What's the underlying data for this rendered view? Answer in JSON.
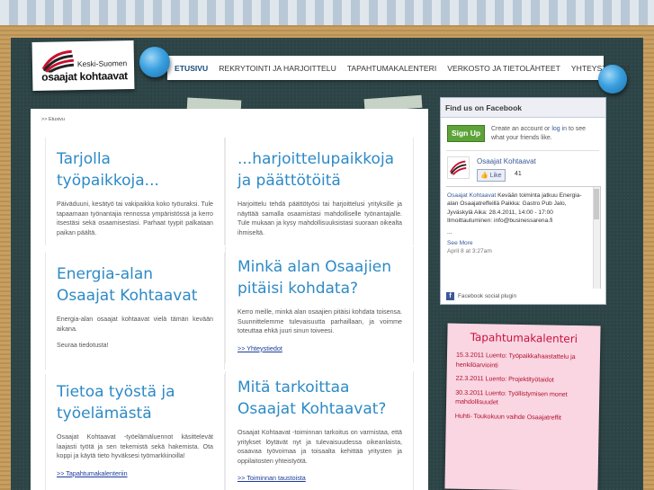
{
  "logo": {
    "line1": "Keski-Suomen",
    "line2": "osaajat kohtaavat"
  },
  "nav": {
    "items": [
      {
        "label": "ETUSIVU",
        "active": true
      },
      {
        "label": "REKRYTOINTI JA HARJOITTELU",
        "active": false
      },
      {
        "label": "TAPAHTUMAKALENTERI",
        "active": false
      },
      {
        "label": "VERKOSTO JA TIETOLÄHTEET",
        "active": false
      },
      {
        "label": "YHTEYSTIEDOT",
        "active": false
      }
    ]
  },
  "breadcrumb": ">> Etusivu",
  "cards": [
    {
      "title": "Tarjolla työpaikkoja...",
      "paragraphs": [
        "Päiväduuni, kesätyö tai vakipaikka koko työuraksi. Tule tapaamaan työnantajia rennossa ympäristössä ja kerro itsestäsi sekä osaamisestasi. Parhaat tyypit palkataan paikan päältä."
      ]
    },
    {
      "title": "...harjoittelupaikkoja ja päättötöitä",
      "paragraphs": [
        "Harjoittelu tehdä päättötyösi tai harjoittelusi yrityksille ja näyttää samalla osaamistasi mahdolliselle työnantajalle. Tule mukaan ja kysy mahdollisuuksistasi suoraan oikealta ihmiseltä."
      ]
    },
    {
      "title": "Energia-alan Osaajat Kohtaavat",
      "paragraphs": [
        "Energia-alan osaajat kohtaavat vielä tämän kevään aikana.",
        "Seuraa tiedotusta!"
      ]
    },
    {
      "title": "Minkä alan Osaajien pitäisi kohdata?",
      "paragraphs": [
        "Kerro meille, minkä alan osaajien pitäisi kohdata toisensa. Suunnittelemme tulevaisuutta parhaillaan, ja voimme toteuttaa ehkä juuri sinun toiveesi."
      ],
      "link": ">> Yhteystiedot"
    },
    {
      "title": "Tietoa työstä ja työelämästä",
      "paragraphs": [
        "Osaajat Kohtaavat -työelämäluennot käsittelevät laajasti työtä ja sen tekemistä sekä hakemista. Ota koppi ja käytä tieto hyväksesi työmarkkinoilla!"
      ],
      "link": ">> Tapahtumakalenteriin"
    },
    {
      "title": "Mitä tarkoittaa Osaajat Kohtaavat?",
      "paragraphs": [
        "Osaajat Kohtaavat -toiminnan tarkoitus on varmistaa, että yritykset löytävät nyt ja tulevaisuudessa oikeanlaista, osaavaa työvoimaa ja toisaalta kehittää yritysten ja oppilaitosten yhteistyötä."
      ],
      "link": ">> Toiminnan taustoista"
    }
  ],
  "facebook": {
    "header": "Find us on Facebook",
    "signup": "Sign Up",
    "cta_pre": "Create an account or ",
    "cta_link": "log in",
    "cta_post": " to see what your friends like.",
    "page_name": "Osaajat Kohtaavat",
    "like_label": "Like",
    "like_count": "41",
    "post_author": "Osaajat Kohtaavat",
    "post_text": " Kevään toiminta jatkuu Energia-alan Osaajatreffeillä Paikka: Gastro Pub Jalo, Jyväskylä Aika: 28.4.2011, 14:00 - 17:00 Ilmoittautuminen: info@businessarena.fi",
    "post_ellipsis": "...",
    "see_more": "See More",
    "post_date": "April 8 at 3:27am",
    "plugin_label": "Facebook social plugin"
  },
  "events": {
    "title": "Tapahtumakalenteri",
    "items": [
      "15.3.2011 Luento: Työpaikkahaastattelu ja henkilöarviointi",
      "22.3.2011 Luento: Projektityötaidot",
      "30.3.2011 Luento: Työllistymisen monet mahdollisuudet",
      "Huhti- Toukokuun vaihde Osaajatreffit"
    ]
  },
  "colors": {
    "heading_blue": "#2d8ac6",
    "board": "#2d4446",
    "wood": "#c59a5a",
    "events_bg": "#f9d6e2",
    "events_text": "#b3102f",
    "fb_blue": "#3b5998",
    "signup_green": "#5da33a"
  }
}
